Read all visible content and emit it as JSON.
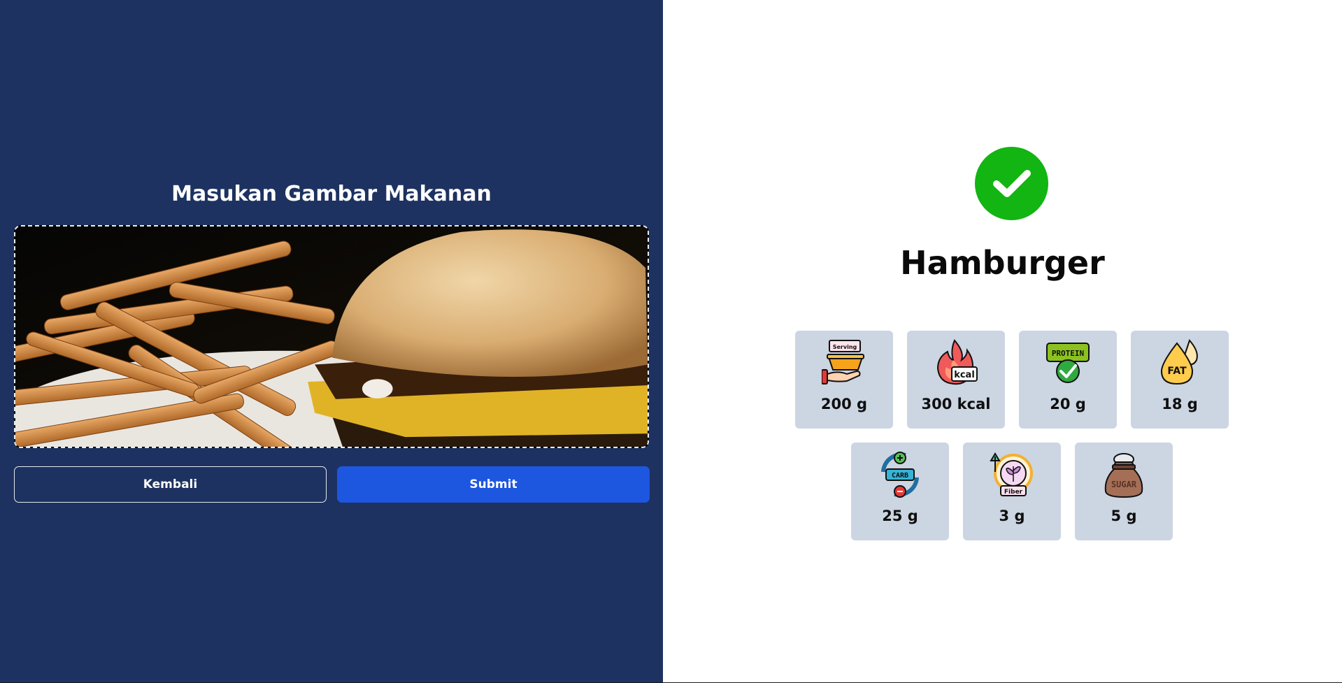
{
  "upload": {
    "title": "Masukan Gambar Makanan",
    "image_alt": "Hamburger dengan kentang goreng"
  },
  "actions": {
    "back_label": "Kembali",
    "submit_label": "Submit"
  },
  "result": {
    "status_icon": "check-circle-icon",
    "food_name": "Hamburger",
    "nutrients": [
      {
        "icon": "serving-icon",
        "icon_text": "Serving",
        "value": "200 g"
      },
      {
        "icon": "kcal-fire-icon",
        "icon_text": "kcal",
        "value": "300 kcal"
      },
      {
        "icon": "protein-icon",
        "icon_text": "PROTEIN",
        "value": "20 g"
      },
      {
        "icon": "fat-drop-icon",
        "icon_text": "FAT",
        "value": "18 g"
      },
      {
        "icon": "carb-cycle-icon",
        "icon_text": "CARB",
        "value": "25 g"
      },
      {
        "icon": "fiber-plant-icon",
        "icon_text": "Fiber",
        "value": "3 g"
      },
      {
        "icon": "sugar-sack-icon",
        "icon_text": "SUGAR",
        "value": "5 g"
      }
    ]
  },
  "colors": {
    "left_panel": "#1d3260",
    "submit_button": "#1d56df",
    "success": "#12b512",
    "card": "#ccd5e2"
  }
}
